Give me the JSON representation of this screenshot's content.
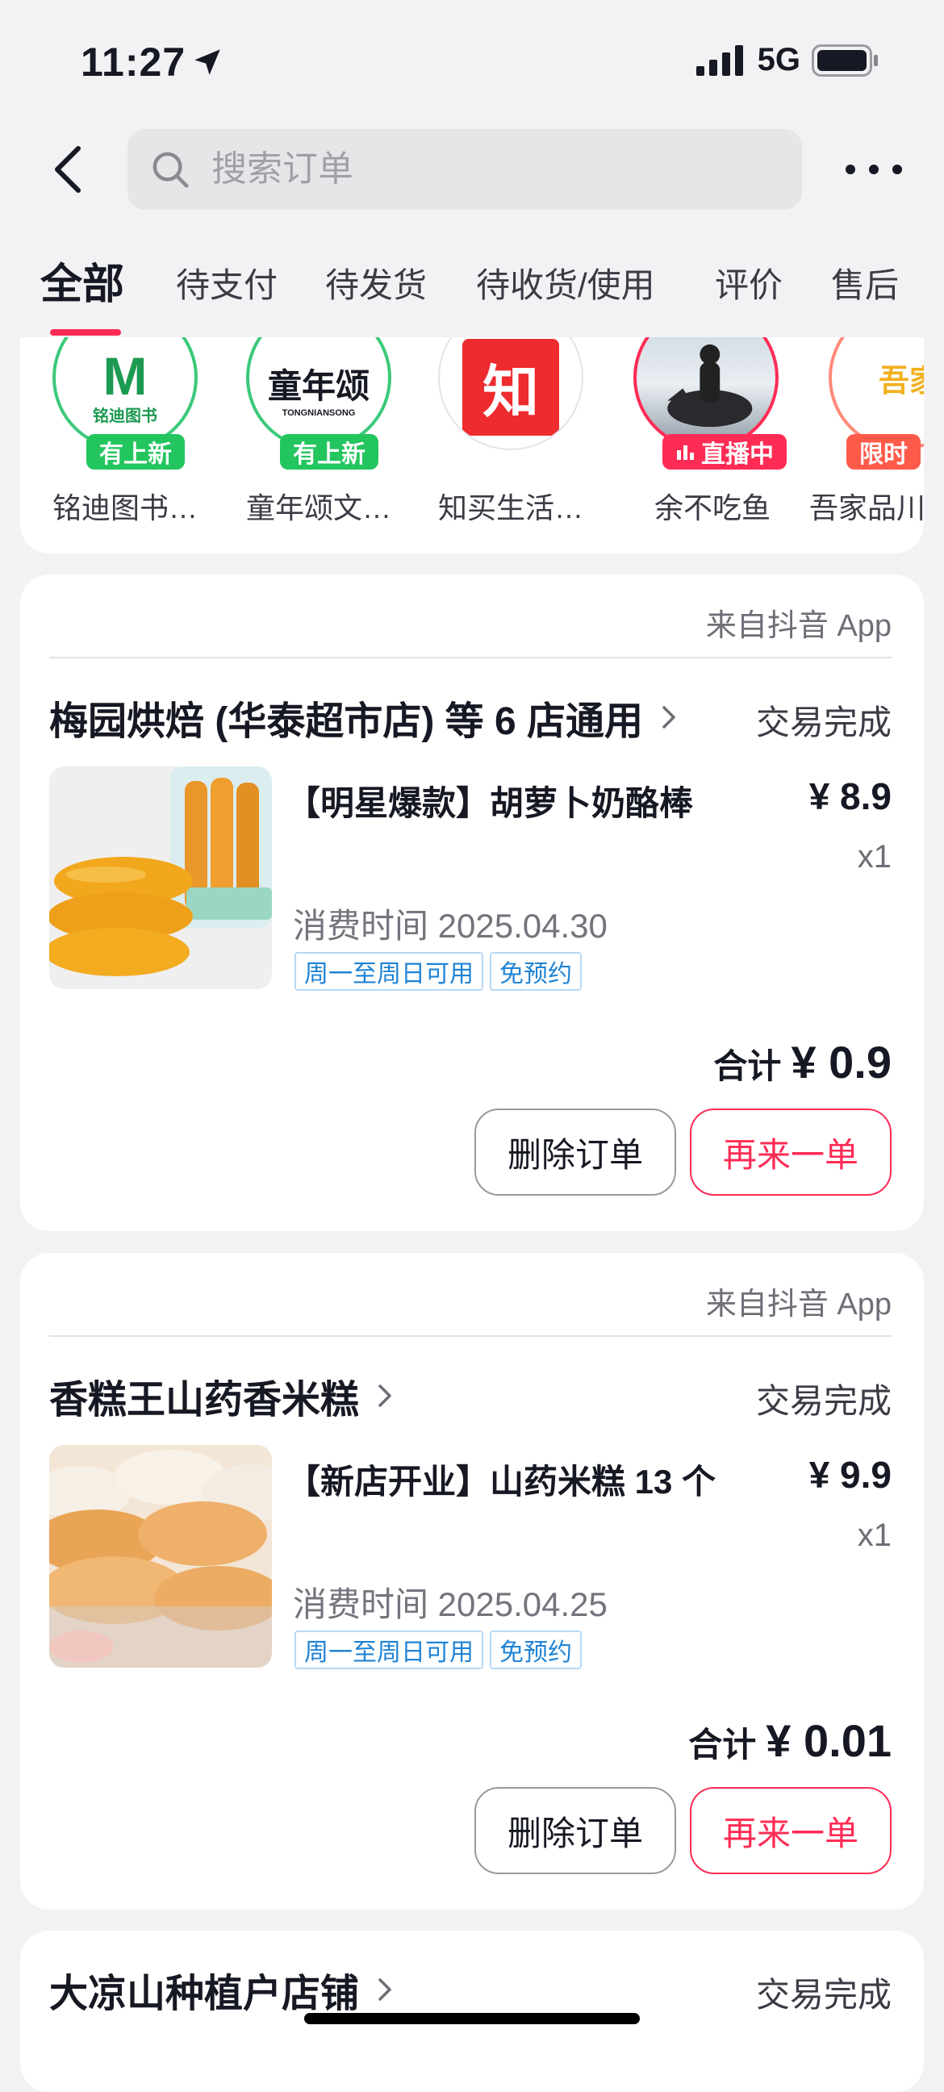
{
  "status_bar": {
    "time": "11:27",
    "network": "5G"
  },
  "header": {
    "search_placeholder": "搜索订单"
  },
  "tabs": [
    "全部",
    "待支付",
    "待发货",
    "待收货/使用",
    "评价",
    "售后"
  ],
  "shops": [
    {
      "name": "铭迪图书…",
      "badge": "有上新",
      "logo_text": "M",
      "logo_sub": "铭迪图书"
    },
    {
      "name": "童年颂文…",
      "badge": "有上新",
      "logo_text": "童年颂",
      "logo_sub": "TONGNIANSONG"
    },
    {
      "name": "知买生活…",
      "badge": "",
      "logo_text": "知"
    },
    {
      "name": "余不吃鱼",
      "badge": "直播中"
    },
    {
      "name": "吾家品川",
      "badge": "限时",
      "logo_text": "吾家"
    }
  ],
  "orders": [
    {
      "source": "来自抖音 App",
      "store": "梅园烘焙 (华泰超市店) 等 6 店通用",
      "status": "交易完成",
      "title": "【明星爆款】胡萝卜奶酪棒",
      "price": "¥ 8.9",
      "qty": "x1",
      "time": "消费时间 2025.04.30",
      "tags": [
        "周一至周日可用",
        "免预约"
      ],
      "total_label": "合计",
      "total": "¥ 0.9",
      "delete_label": "删除订单",
      "reorder_label": "再来一单"
    },
    {
      "source": "来自抖音 App",
      "store": "香糕王山药香米糕",
      "status": "交易完成",
      "title": "【新店开业】山药米糕 13 个",
      "price": "¥ 9.9",
      "qty": "x1",
      "time": "消费时间 2025.04.25",
      "tags": [
        "周一至周日可用",
        "免预约"
      ],
      "total_label": "合计",
      "total": "¥ 0.01",
      "delete_label": "删除订单",
      "reorder_label": "再来一单"
    },
    {
      "store": "大凉山种植户店铺",
      "status": "交易完成"
    }
  ],
  "colors": {
    "accent": "#fe2c55",
    "new_badge": "#22c55e",
    "tag_blue": "#1f83d4"
  }
}
